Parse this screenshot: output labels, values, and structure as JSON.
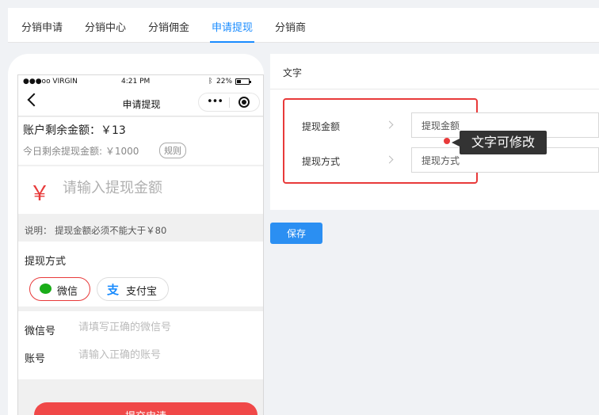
{
  "tabs": [
    {
      "label": "分销申请"
    },
    {
      "label": "分销中心"
    },
    {
      "label": "分销佣金"
    },
    {
      "label": "申请提现",
      "active": true
    },
    {
      "label": "分销商"
    }
  ],
  "accent_color": "#1a8cff",
  "phone": {
    "status_bar": {
      "carrier": "●●●oo VIRGIN",
      "time": "4:21 PM",
      "battery": "22%"
    },
    "nav_title": "申请提现",
    "balance_text": "账户剩余金额：￥13",
    "today_text": "今日剩余提现金额: ￥1000",
    "rule_label": "规则",
    "currency_symbol": "￥",
    "amount_placeholder": "请输入提现金额",
    "note": "说明：   提现金额必须不能大于￥80",
    "method_title": "提现方式",
    "methods": [
      {
        "label": "微信",
        "selected": true
      },
      {
        "label": "支付宝",
        "selected": false
      }
    ],
    "wechat_label": "微信号",
    "wechat_placeholder": "请填写正确的微信号",
    "account_label": "账号",
    "account_placeholder": "请输入正确的账号",
    "submit_label": "提交申请",
    "primary_red": "#f04848"
  },
  "editor": {
    "title": "文字",
    "fields": [
      {
        "label": "提现金额",
        "value": "提现金额"
      },
      {
        "label": "提现方式",
        "value": "提现方式"
      }
    ],
    "tooltip": "文字可修改",
    "save_label": "保存"
  }
}
